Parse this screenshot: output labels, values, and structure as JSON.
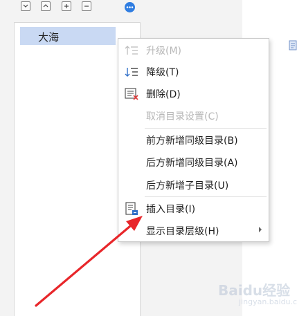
{
  "tree": {
    "items": [
      {
        "label": "大海",
        "selected": true
      }
    ]
  },
  "toolbar": {
    "buttons": [
      {
        "icon": "chevron-down-icon"
      },
      {
        "icon": "chevron-up-icon"
      },
      {
        "icon": "plus-icon"
      },
      {
        "icon": "minus-icon"
      },
      {
        "icon": "blue-dots-icon"
      }
    ]
  },
  "context_menu": {
    "items": [
      {
        "label": "升级(M)",
        "icon": "promote-icon",
        "enabled": false
      },
      {
        "label": "降级(T)",
        "icon": "demote-icon",
        "enabled": true
      },
      {
        "label": "删除(D)",
        "icon": "delete-list-icon",
        "enabled": true
      },
      {
        "label": "取消目录设置(C)",
        "icon": "",
        "enabled": false
      },
      {
        "label": "前方新增同级目录(B)",
        "icon": "",
        "enabled": true
      },
      {
        "label": "后方新增同级目录(A)",
        "icon": "",
        "enabled": true
      },
      {
        "label": "后方新增子目录(U)",
        "icon": "",
        "enabled": true
      },
      {
        "label": "插入目录(I)",
        "icon": "insert-toc-icon",
        "enabled": true
      },
      {
        "label": "显示目录层级(H)",
        "icon": "",
        "enabled": true,
        "has_submenu": true
      }
    ]
  },
  "watermark": {
    "text": "Baidu经验",
    "sub": "jingyan.baidu.com"
  },
  "colors": {
    "selection": "#c9d9f3",
    "annotation_red": "#e8262a",
    "accent_blue": "#2f7de1"
  }
}
